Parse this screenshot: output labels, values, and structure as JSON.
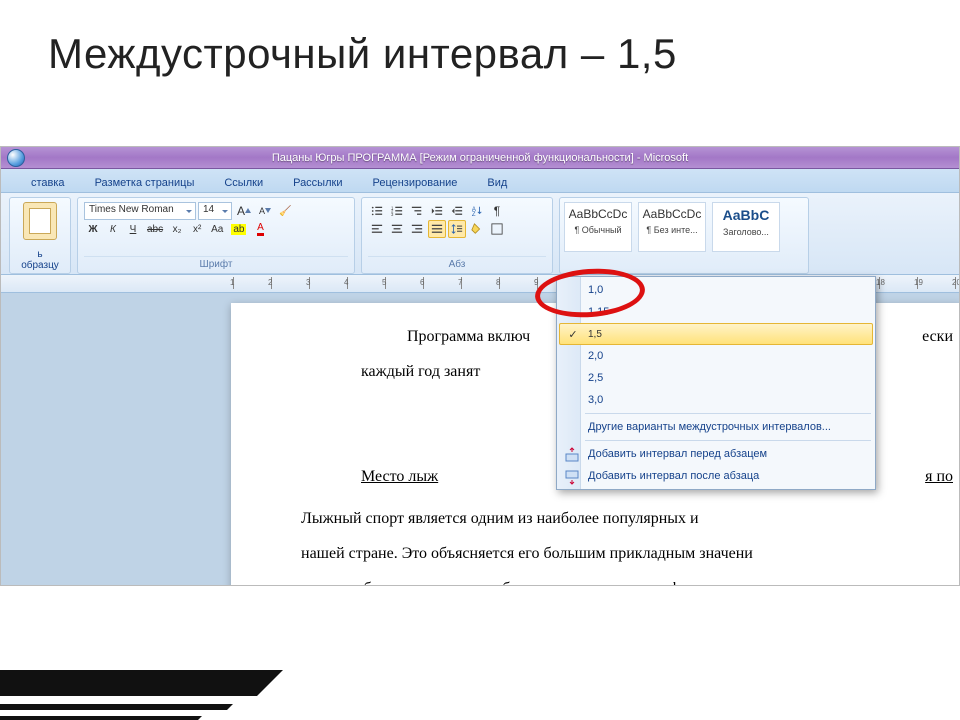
{
  "slide": {
    "title": "Междустрочный интервал – 1,5"
  },
  "window": {
    "title": "Пацаны Югры ПРОГРАММА [Режим ограниченной функциональности] - Microsoft"
  },
  "tabs": {
    "insert": "ставка",
    "layout": "Разметка страницы",
    "refs": "Ссылки",
    "mailings": "Рассылки",
    "review": "Рецензирование",
    "view": "Вид"
  },
  "clipboard": {
    "paste_cap1": "ь",
    "paste_cap2": "образцу"
  },
  "font_group": {
    "label": "Шрифт",
    "font_name": "Times New Roman",
    "font_size": "14",
    "bold": "Ж",
    "italic": "К",
    "underline": "Ч",
    "strike": "abc",
    "sub": "x₂",
    "sup": "x²",
    "case": "Aa",
    "highlight": "ab",
    "color": "A"
  },
  "para_group": {
    "label": "Абз"
  },
  "styles": {
    "s1_preview": "AaBbCcDc",
    "s1_name": "¶ Обычный",
    "s2_preview": "AaBbCcDc",
    "s2_name": "¶ Без инте...",
    "s3_preview": "AaBbC",
    "s3_name": "Заголово..."
  },
  "menu": {
    "items": [
      "1,0",
      "1,15",
      "1,5",
      "2,0",
      "2,5",
      "3,0"
    ],
    "selected_index": 2,
    "other": "Другие варианты междустрочных интервалов...",
    "before": "Добавить интервал перед абзацем",
    "after": "Добавить интервал после абзаца"
  },
  "doc": {
    "line1": "Программа включ",
    "line2": "каждый год занят",
    "heading": "Место лыж",
    "body_tail1": "я по",
    "body_tail0": "ески",
    "p1": "Лыжный спорт является одним из наиболее популярных и",
    "p2": "нашей стране. Это объясняется его большим прикладным значени",
    "p3": "ходить и бегать на лыжах необходимо для многих професси"
  }
}
